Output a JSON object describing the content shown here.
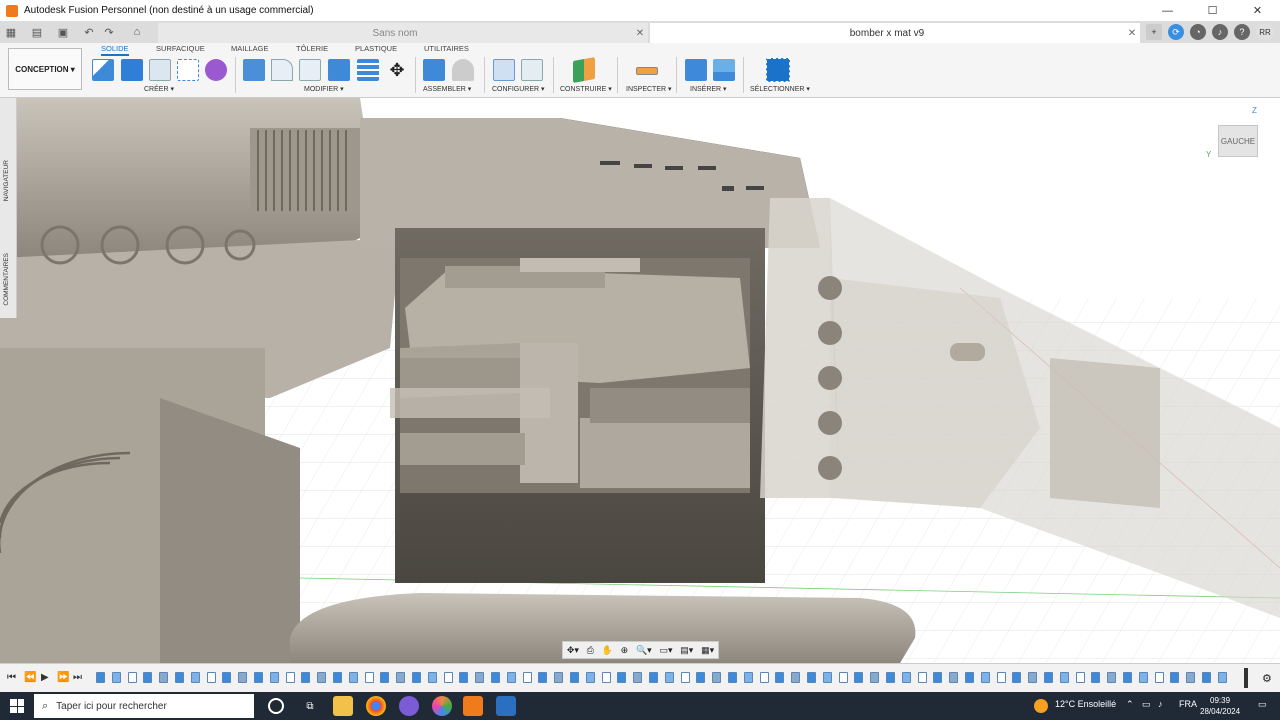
{
  "window": {
    "title": "Autodesk Fusion Personnel (non destiné à un usage commercial)",
    "minimize": "—",
    "maximize": "☐",
    "close": "✕"
  },
  "tabs": [
    {
      "label": "Sans nom",
      "close": "✕"
    },
    {
      "label": "bomber x mat v9",
      "close": "✕"
    }
  ],
  "tab_add": "+",
  "user": {
    "initials": "RR"
  },
  "toolbar": {
    "workspace": "CONCEPTION ▾",
    "ribbon_tabs": [
      "SOLIDE",
      "SURFACIQUE",
      "MAILLAGE",
      "TÔLERIE",
      "PLASTIQUE",
      "UTILITAIRES"
    ],
    "groups": [
      "CRÉER ▾",
      "MODIFIER ▾",
      "ASSEMBLER ▾",
      "CONFIGURER ▾",
      "CONSTRUIRE ▾",
      "INSPECTER ▾",
      "INSÉRER ▾",
      "SÉLECTIONNER ▾"
    ]
  },
  "browser": {
    "navigator": "NAVIGATEUR",
    "comments": "COMMENTAIRES"
  },
  "viewcube": {
    "face": "GAUCHE",
    "z": "Z",
    "y": "Y"
  },
  "navbar": [
    "✥▾",
    "⎙",
    "✋",
    "⊕",
    "🔍▾",
    "▭▾",
    "▤▾",
    "▦▾"
  ],
  "timeline": {
    "controls": [
      "⏮",
      "⏪",
      "▶",
      "⏩",
      "⏭"
    ],
    "gear": "⚙"
  },
  "taskbar": {
    "search_placeholder": "Taper ici pour rechercher",
    "weather": "12°C  Ensoleillé",
    "lang": "FRA",
    "time": "09:39",
    "date": "28/04/2024"
  },
  "colors": {
    "accent": "#1a73c9",
    "model": "#a8a299"
  }
}
